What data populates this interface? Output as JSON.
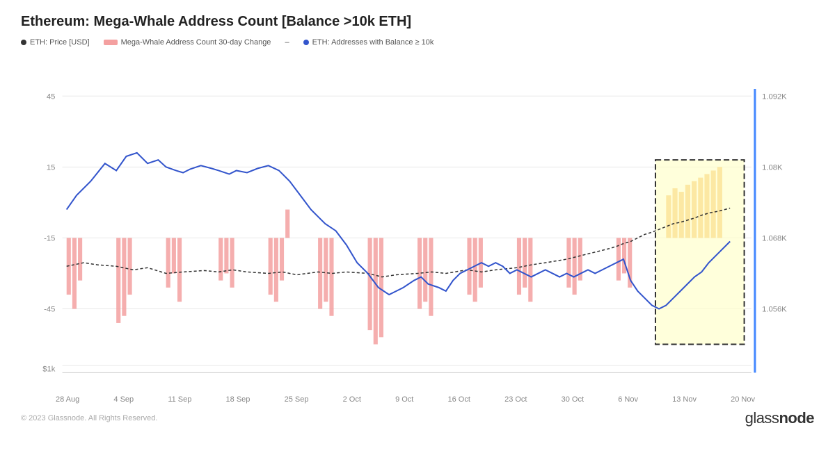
{
  "title": "Ethereum: Mega-Whale Address Count [Balance >10k ETH]",
  "legend": {
    "items": [
      {
        "id": "eth-price",
        "label": "ETH: Price [USD]",
        "type": "dot-black"
      },
      {
        "id": "mega-whale-change",
        "label": "Mega-Whale Address Count 30-day Change",
        "type": "dash-pink"
      },
      {
        "id": "dash-separator",
        "label": "–",
        "type": "dash-gray"
      },
      {
        "id": "eth-addresses",
        "label": "ETH: Addresses with Balance ≥ 10k",
        "type": "dot-blue"
      }
    ]
  },
  "x_axis": {
    "labels": [
      "28 Aug",
      "4 Sep",
      "11 Sep",
      "18 Sep",
      "25 Sep",
      "2 Oct",
      "9 Oct",
      "16 Oct",
      "23 Oct",
      "30 Oct",
      "6 Nov",
      "13 Nov",
      "20 Nov"
    ]
  },
  "y_axis_left": {
    "labels": [
      "45",
      "15",
      "-15",
      "-45"
    ],
    "bottom_label": "$1k"
  },
  "y_axis_right": {
    "labels": [
      "1.092K",
      "1.08K",
      "1.068K",
      "1.056K"
    ]
  },
  "footer": {
    "copyright": "© 2023 Glassnode. All Rights Reserved.",
    "logo": "glassnode"
  },
  "highlight_box": {
    "label": "highlighted region",
    "x_start": 0.82,
    "x_end": 0.97,
    "y_start": 0.3,
    "y_end": 0.9
  }
}
